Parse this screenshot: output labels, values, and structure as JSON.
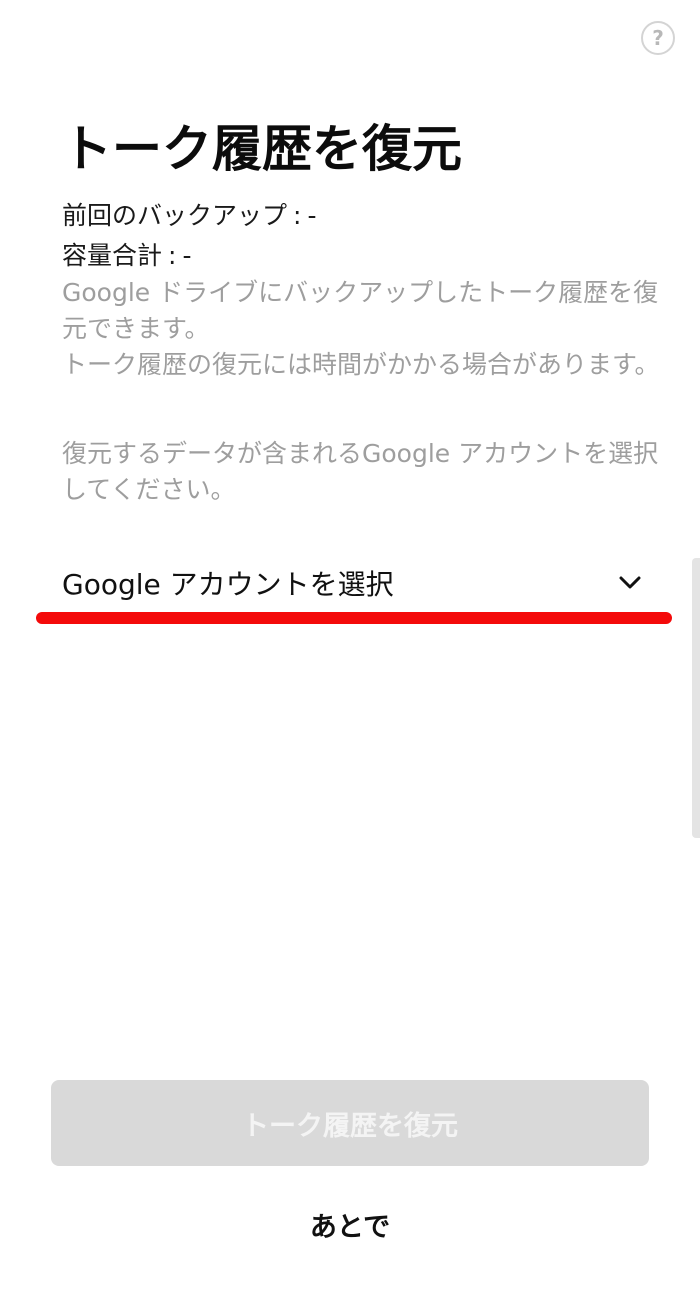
{
  "help": {
    "glyph": "?"
  },
  "page": {
    "title": "トーク履歴を復元"
  },
  "info": {
    "last_backup_label": "前回のバックアップ",
    "last_backup_value": "-",
    "total_size_label": "容量合計",
    "total_size_value": "-",
    "separator": ":"
  },
  "description": {
    "paragraph_1": "Google ドライブにバックアップしたトーク履歴を復元できます。\nトーク履歴の復元には時間がかかる場合があります。",
    "paragraph_2": "復元するデータが含まれるGoogle アカウントを選択してください。"
  },
  "account_selector": {
    "label": "Google アカウントを選択",
    "icon": "chevron-down-icon"
  },
  "buttons": {
    "restore_label": "トーク履歴を復元",
    "later_label": "あとで"
  },
  "colors": {
    "annotation_red": "#f40a0a",
    "disabled_button_bg": "#d9d9d9",
    "muted_text": "#9e9e9e"
  }
}
